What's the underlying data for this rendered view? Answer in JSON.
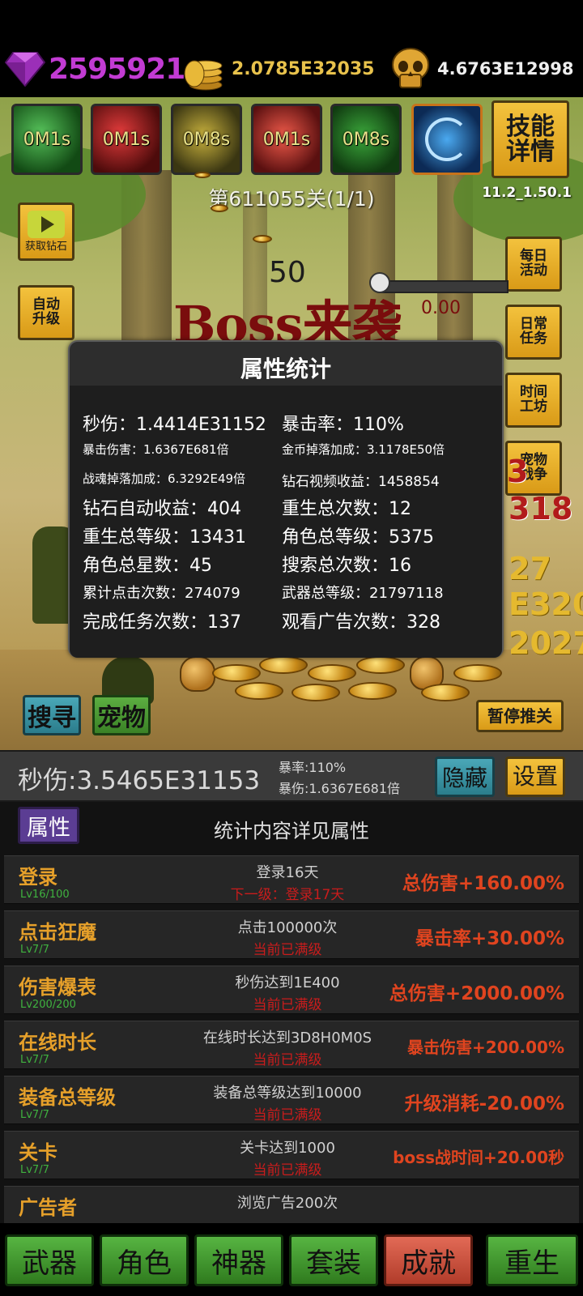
{
  "currencies": {
    "diamond": {
      "icon": "diamond-icon",
      "value": "2595921"
    },
    "gold": {
      "icon": "gold-coins-icon",
      "value": "2.0785E32035"
    },
    "soul": {
      "icon": "golden-skull-icon",
      "value": "4.6763E12998"
    }
  },
  "skills": [
    {
      "cooldown": "0M1s",
      "icon": "skill-green-icon"
    },
    {
      "cooldown": "0M1s",
      "icon": "skill-red-silhouette-icon"
    },
    {
      "cooldown": "0M8s",
      "icon": "skill-gold-icon"
    },
    {
      "cooldown": "0M1s",
      "icon": "skill-fire-icon"
    },
    {
      "cooldown": "0M8s",
      "icon": "skill-poison-icon"
    },
    {
      "cooldown": "",
      "icon": "skill-vortex-icon"
    }
  ],
  "skill_detail_label": "技能\n详情",
  "stage_label": "第611055关(1/1)",
  "version": "11.2_1.50.1",
  "side_buttons": {
    "video_diamond": "获取钻石",
    "auto_upgrade": "自动\n升级",
    "daily_activity": "每日\n活动",
    "daily_task": "日常\n任务",
    "time_workshop": "时间\n工坊",
    "pet_battle": "宠物\n战争"
  },
  "boss": {
    "timer": "50",
    "banner": "Boss来袭",
    "hp_value": "0.00",
    "hp_fraction": 0
  },
  "scene_buttons": {
    "search": "搜寻",
    "pet": "宠物",
    "pause_push": "暂停推关"
  },
  "stats": {
    "title": "属性统计",
    "rows": [
      {
        "size": "large",
        "left": "秒伤：1.4414E31152",
        "right": "暴击率：110%"
      },
      {
        "size": "small",
        "left": "暴击伤害：1.6367E681倍",
        "right": "金币掉落加成：3.1178E50倍"
      },
      {
        "size": "small",
        "left": "战魂掉落加成：6.3292E49倍",
        "right": "钻石视频收益：1458854"
      },
      {
        "size": "large",
        "left": "钻石自动收益：404",
        "right": "重生总次数：12"
      },
      {
        "size": "large",
        "left": "重生总等级：13431",
        "right": "角色总等级：5375"
      },
      {
        "size": "large",
        "left": "角色总星数：45",
        "right": "搜索总次数：16"
      },
      {
        "size": "medium",
        "left": "累计点击次数：274079",
        "right": "武器总等级：21797118"
      },
      {
        "size": "large",
        "left": "完成任务次数：137",
        "right": "观看广告次数：328"
      }
    ]
  },
  "dps_bar": {
    "dps": "秒伤:3.5465E31153",
    "crit_rate": "暴率:110%",
    "crit_damage": "暴伤:1.6367E681倍",
    "hide": "隐藏",
    "settings": "设置"
  },
  "panel": {
    "tab": "属性",
    "hint": "统计内容详见属性",
    "achievements": [
      {
        "name": "登录",
        "level": "Lv16/100",
        "desc": "登录16天",
        "status": "下一级：登录17天",
        "reward": "总伤害+160.00%"
      },
      {
        "name": "点击狂魔",
        "level": "Lv7/7",
        "desc": "点击100000次",
        "status": "当前已满级",
        "reward": "暴击率+30.00%"
      },
      {
        "name": "伤害爆表",
        "level": "Lv200/200",
        "desc": "秒伤达到1E400",
        "status": "当前已满级",
        "reward": "总伤害+2000.00%"
      },
      {
        "name": "在线时长",
        "level": "Lv7/7",
        "desc": "在线时长达到3D8H0M0S",
        "status": "当前已满级",
        "reward": "暴击伤害+200.00%"
      },
      {
        "name": "装备总等级",
        "level": "Lv7/7",
        "desc": "装备总等级达到10000",
        "status": "当前已满级",
        "reward": "升级消耗-20.00%"
      },
      {
        "name": "关卡",
        "level": "Lv7/7",
        "desc": "关卡达到1000",
        "status": "当前已满级",
        "reward": "boss战时间+20.00秒"
      },
      {
        "name": "广告者",
        "level": "",
        "desc": "浏览广告200次",
        "status": "",
        "reward": ""
      }
    ]
  },
  "bottom_nav": [
    {
      "label": "武器",
      "active": false
    },
    {
      "label": "角色",
      "active": false
    },
    {
      "label": "神器",
      "active": false
    },
    {
      "label": "套装",
      "active": false
    },
    {
      "label": "成就",
      "active": true
    },
    {
      "label": "重生",
      "active": false
    }
  ]
}
